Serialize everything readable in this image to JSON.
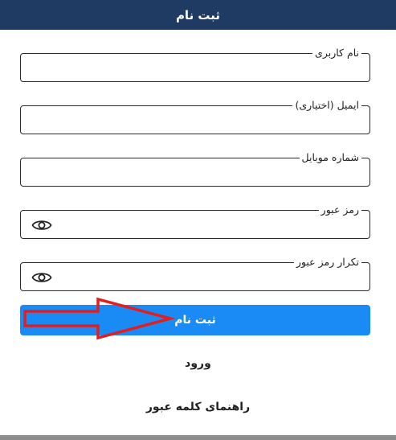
{
  "header": {
    "title": "ثبت نام"
  },
  "form": {
    "username": {
      "label": "نام کاربری",
      "value": ""
    },
    "email": {
      "label": "ایمیل (اختیاری)",
      "value": ""
    },
    "mobile": {
      "label": "شماره موبایل",
      "value": ""
    },
    "password": {
      "label": "رمز عبور",
      "value": "",
      "icon": "eye-icon"
    },
    "password_confirm": {
      "label": "تکرار رمز عبور",
      "value": "",
      "icon": "eye-icon"
    }
  },
  "submit_label": "ثبت نام",
  "links": {
    "login": "ورود",
    "password_help": "راهنمای کلمه عبور"
  },
  "colors": {
    "header": "#1f3a63",
    "button": "#1a8af5",
    "annotation_arrow": "#e02020"
  }
}
